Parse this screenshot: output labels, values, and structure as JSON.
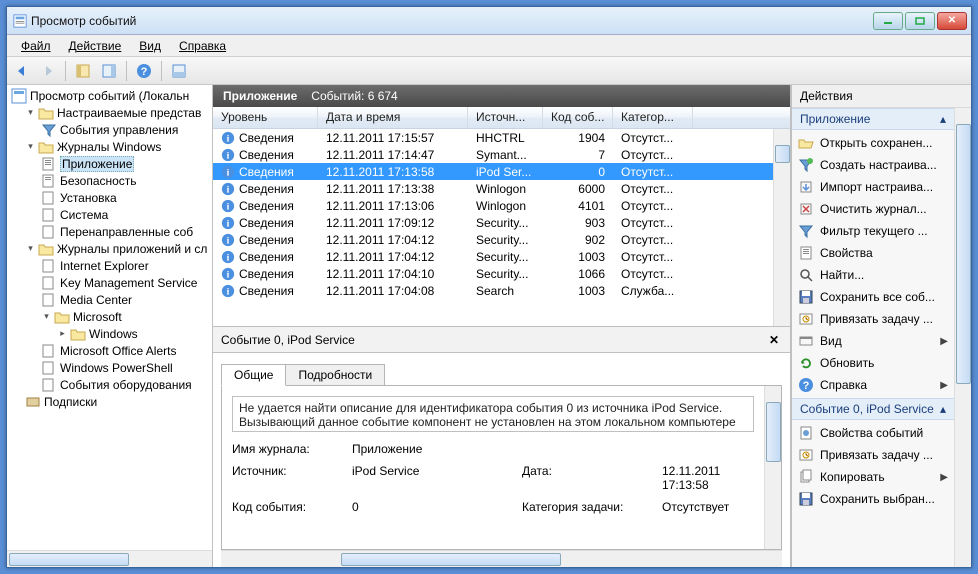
{
  "window": {
    "title": "Просмотр событий"
  },
  "menu": {
    "file": "Файл",
    "action": "Действие",
    "view": "Вид",
    "help": "Справка"
  },
  "tree": {
    "root": "Просмотр событий (Локальн",
    "custom_views": "Настраиваемые представ",
    "admin_events": "События управления",
    "win_logs": "Журналы Windows",
    "app": "Приложение",
    "security": "Безопасность",
    "setup": "Установка",
    "system": "Система",
    "forwarded": "Перенаправленные соб",
    "app_service_logs": "Журналы приложений и сл",
    "ie": "Internet Explorer",
    "kms": "Key Management Service",
    "mc": "Media Center",
    "ms": "Microsoft",
    "windows": "Windows",
    "office_alerts": "Microsoft Office Alerts",
    "powershell": "Windows PowerShell",
    "hw_events": "События оборудования",
    "subscriptions": "Подписки"
  },
  "center": {
    "title": "Приложение",
    "count_label": "Событий: 6 674"
  },
  "columns": {
    "level": "Уровень",
    "datetime": "Дата и время",
    "source": "Источн...",
    "eventid": "Код соб...",
    "category": "Категор..."
  },
  "rows": [
    {
      "level": "Сведения",
      "dt": "12.11.2011 17:15:57",
      "src": "HHCTRL",
      "id": "1904",
      "cat": "Отсутст..."
    },
    {
      "level": "Сведения",
      "dt": "12.11.2011 17:14:47",
      "src": "Symant...",
      "id": "7",
      "cat": "Отсутст..."
    },
    {
      "level": "Сведения",
      "dt": "12.11.2011 17:13:58",
      "src": "iPod Ser...",
      "id": "0",
      "cat": "Отсутст...",
      "selected": true
    },
    {
      "level": "Сведения",
      "dt": "12.11.2011 17:13:38",
      "src": "Winlogon",
      "id": "6000",
      "cat": "Отсутст..."
    },
    {
      "level": "Сведения",
      "dt": "12.11.2011 17:13:06",
      "src": "Winlogon",
      "id": "4101",
      "cat": "Отсутст..."
    },
    {
      "level": "Сведения",
      "dt": "12.11.2011 17:09:12",
      "src": "Security...",
      "id": "903",
      "cat": "Отсутст..."
    },
    {
      "level": "Сведения",
      "dt": "12.11.2011 17:04:12",
      "src": "Security...",
      "id": "902",
      "cat": "Отсутст..."
    },
    {
      "level": "Сведения",
      "dt": "12.11.2011 17:04:12",
      "src": "Security...",
      "id": "1003",
      "cat": "Отсутст..."
    },
    {
      "level": "Сведения",
      "dt": "12.11.2011 17:04:10",
      "src": "Security...",
      "id": "1066",
      "cat": "Отсутст..."
    },
    {
      "level": "Сведения",
      "dt": "12.11.2011 17:04:08",
      "src": "Search",
      "id": "1003",
      "cat": "Служба..."
    }
  ],
  "detail": {
    "header": "Событие 0, iPod Service",
    "tab_general": "Общие",
    "tab_details": "Подробности",
    "description": "Не удается найти описание для идентификатора события 0 из источника iPod Service. Вызывающий данное событие компонент не установлен на этом локальном компьютере",
    "log_name_lbl": "Имя журнала:",
    "log_name": "Приложение",
    "source_lbl": "Источник:",
    "source": "iPod Service",
    "date_lbl": "Дата:",
    "date": "12.11.2011 17:13:58",
    "eventid_lbl": "Код события:",
    "eventid": "0",
    "taskcat_lbl": "Категория задачи:",
    "taskcat": "Отсутствует"
  },
  "actions": {
    "pane_title": "Действия",
    "group1": "Приложение",
    "items1": [
      {
        "icon": "folder-open-icon",
        "label": "Открыть сохранен..."
      },
      {
        "icon": "filter-new-icon",
        "label": "Создать настраива..."
      },
      {
        "icon": "import-icon",
        "label": "Импорт настраива..."
      },
      {
        "icon": "clear-log-icon",
        "label": "Очистить журнал..."
      },
      {
        "icon": "filter-icon",
        "label": "Фильтр текущего ..."
      },
      {
        "icon": "properties-icon",
        "label": "Свойства"
      },
      {
        "icon": "find-icon",
        "label": "Найти..."
      },
      {
        "icon": "save-icon",
        "label": "Сохранить все соб..."
      },
      {
        "icon": "task-icon",
        "label": "Привязать задачу ..."
      },
      {
        "icon": "view-icon",
        "label": "Вид",
        "chev": true
      },
      {
        "icon": "refresh-icon",
        "label": "Обновить"
      },
      {
        "icon": "help-icon",
        "label": "Справка",
        "chev": true
      }
    ],
    "group2": "Событие 0, iPod Service",
    "items2": [
      {
        "icon": "event-props-icon",
        "label": "Свойства событий"
      },
      {
        "icon": "task-icon",
        "label": "Привязать задачу ..."
      },
      {
        "icon": "copy-icon",
        "label": "Копировать",
        "chev": true
      },
      {
        "icon": "save-icon",
        "label": "Сохранить выбран..."
      }
    ]
  }
}
